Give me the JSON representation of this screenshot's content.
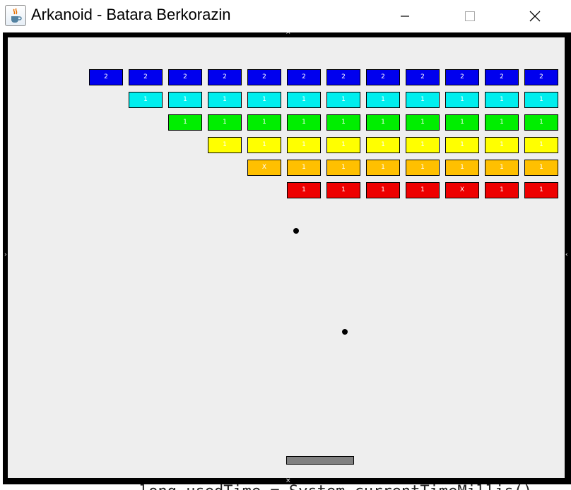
{
  "window": {
    "title": "Arkanoid - Batara Berkorazin",
    "icon": "java-cup-icon",
    "controls": {
      "minimize_icon": "minimize-icon",
      "maximize_icon": "maximize-icon",
      "close_icon": "close-icon"
    }
  },
  "background_code_fragment": "long usedTime = System.currentTimeMillis()",
  "game": {
    "brick_rows": [
      {
        "color": "#0000ee",
        "labels": [
          "2",
          "2",
          "2",
          "2",
          "2",
          "2",
          "2",
          "2",
          "2",
          "2",
          "2",
          "2"
        ]
      },
      {
        "color": "#00eeee",
        "labels": [
          "1",
          "1",
          "1",
          "1",
          "1",
          "1",
          "1",
          "1",
          "1",
          "1",
          "1"
        ]
      },
      {
        "color": "#00ee00",
        "labels": [
          "1",
          "1",
          "1",
          "1",
          "1",
          "1",
          "1",
          "1",
          "1",
          "1"
        ]
      },
      {
        "color": "#ffff00",
        "labels": [
          "1",
          "1",
          "1",
          "1",
          "1",
          "1",
          "1",
          "1",
          "1"
        ]
      },
      {
        "color": "#ffc000",
        "labels": [
          "X",
          "1",
          "1",
          "1",
          "1",
          "1",
          "1",
          "1"
        ]
      },
      {
        "color": "#ee0000",
        "labels": [
          "1",
          "1",
          "1",
          "1",
          "X",
          "1",
          "1"
        ]
      }
    ],
    "balls": 2,
    "paddle_color": "#808080"
  }
}
